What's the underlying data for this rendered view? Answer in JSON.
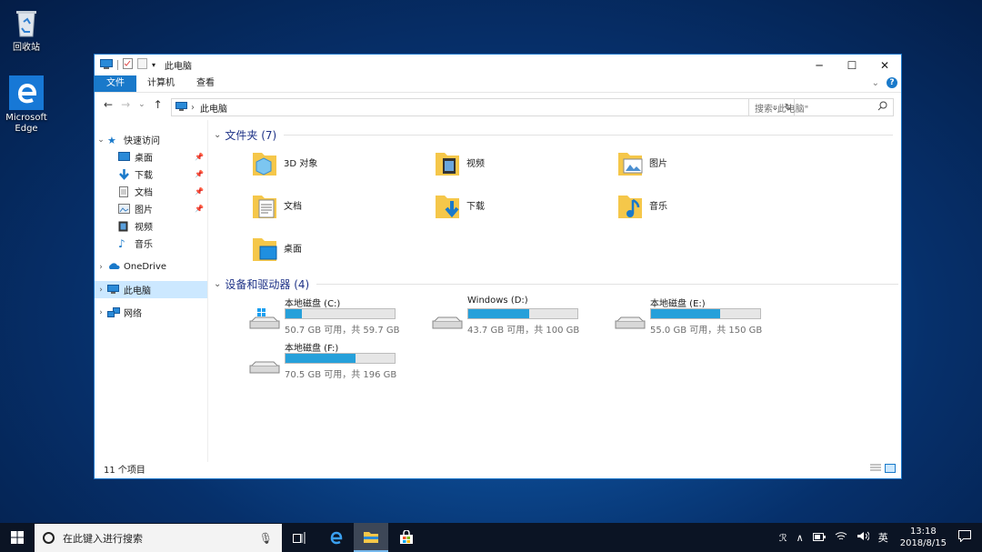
{
  "desktop": {
    "icons": [
      {
        "label": "回收站",
        "icon": "recycle-bin-icon"
      },
      {
        "label": "Microsoft Edge",
        "icon": "edge-icon"
      }
    ]
  },
  "window": {
    "title": "此电脑",
    "controls": {
      "minimize": "─",
      "maximize": "☐",
      "close": "✕"
    },
    "ribbon": {
      "tabs": [
        "文件",
        "计算机",
        "查看"
      ],
      "expand": "⌄",
      "help": "?"
    },
    "address": {
      "path": "此电脑",
      "separator": "›",
      "dropdown": "⌄",
      "refresh": "↻"
    },
    "search_placeholder": "搜索\"此电脑\"",
    "nav": {
      "back": "←",
      "forward": "→",
      "recent": "⌄",
      "up": "↑"
    }
  },
  "sidebar": {
    "quick_access": "快速访问",
    "items": [
      {
        "label": "桌面",
        "icon": "desktop-icon",
        "pinned": true
      },
      {
        "label": "下载",
        "icon": "download-icon",
        "pinned": true
      },
      {
        "label": "文档",
        "icon": "documents-icon",
        "pinned": true
      },
      {
        "label": "图片",
        "icon": "pictures-icon",
        "pinned": true
      },
      {
        "label": "视频",
        "icon": "videos-icon",
        "pinned": false
      },
      {
        "label": "音乐",
        "icon": "music-icon",
        "pinned": false
      }
    ],
    "onedrive": "OneDrive",
    "this_pc": "此电脑",
    "network": "网络",
    "pin_glyph": "📌"
  },
  "content": {
    "folders_header": "文件夹 (7)",
    "folders": [
      {
        "label": "3D 对象",
        "icon": "3d-objects-icon"
      },
      {
        "label": "视频",
        "icon": "videos-folder-icon"
      },
      {
        "label": "图片",
        "icon": "pictures-folder-icon"
      },
      {
        "label": "文档",
        "icon": "documents-folder-icon"
      },
      {
        "label": "下载",
        "icon": "downloads-folder-icon"
      },
      {
        "label": "音乐",
        "icon": "music-folder-icon"
      },
      {
        "label": "桌面",
        "icon": "desktop-folder-icon"
      }
    ],
    "drives_header": "设备和驱动器 (4)",
    "drives": [
      {
        "name": "本地磁盘 (C:)",
        "info": "50.7 GB 可用，共 59.7 GB",
        "used_fraction": 0.15,
        "icon": "system-drive-icon"
      },
      {
        "name": "Windows (D:)",
        "info": "43.7 GB 可用，共 100 GB",
        "used_fraction": 0.56,
        "icon": "drive-icon"
      },
      {
        "name": "本地磁盘 (E:)",
        "info": "55.0 GB 可用，共 150 GB",
        "used_fraction": 0.63,
        "icon": "drive-icon"
      },
      {
        "name": "本地磁盘 (F:)",
        "info": "70.5 GB 可用，共 196 GB",
        "used_fraction": 0.64,
        "icon": "drive-icon"
      }
    ]
  },
  "status": {
    "count": "11 个项目"
  },
  "taskbar": {
    "search_placeholder": "在此键入进行搜索",
    "tray": {
      "people": "ℛ",
      "chevron": "∧",
      "ime": "英",
      "volume": "🕪"
    },
    "time": "13:18",
    "date": "2018/8/15"
  },
  "colors": {
    "accent": "#1979ca",
    "bar_fill": "#26a0da",
    "header_text": "#1e3287",
    "selection": "#cce8ff"
  }
}
